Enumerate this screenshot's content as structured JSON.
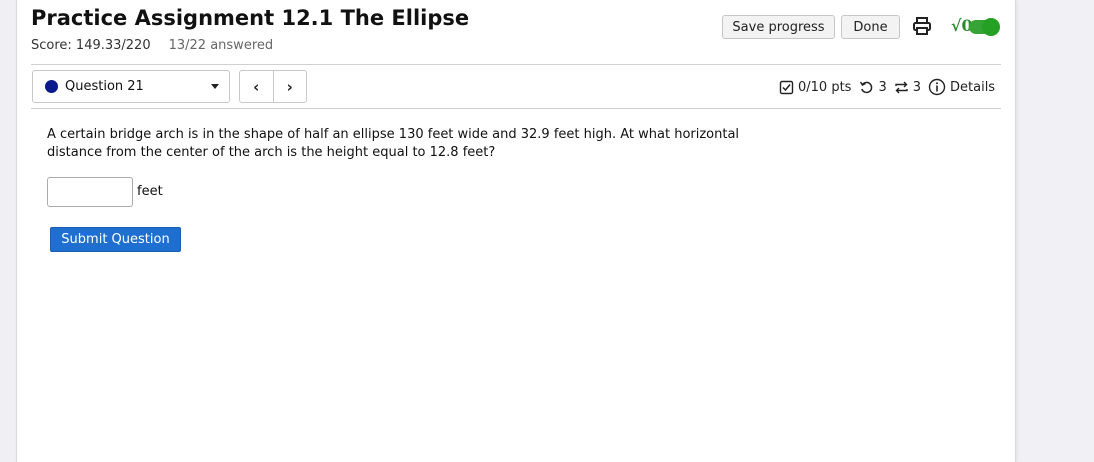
{
  "header": {
    "title": "Practice Assignment 12.1 The Ellipse",
    "score": "Score: 149.33/220",
    "answered": "13/22 answered",
    "save_label": "Save progress",
    "done_label": "Done",
    "sqrt_label": "√0"
  },
  "question_nav": {
    "selected": "Question 21",
    "prev_symbol": "‹",
    "next_symbol": "›"
  },
  "meta": {
    "points": "0/10 pts",
    "retries": "3",
    "attempts": "3",
    "details_label": "Details"
  },
  "question": {
    "text": "A certain bridge arch is in the shape of half an ellipse 130 feet wide and 32.9 feet high. At what horizontal distance from the center of the arch is the height equal to 12.8 feet?",
    "answer_value": "",
    "unit": "feet",
    "submit_label": "Submit Question"
  },
  "colors": {
    "accent": "#1e6fd0",
    "toggle": "#35a335",
    "question_dot": "#0a1a8c"
  }
}
